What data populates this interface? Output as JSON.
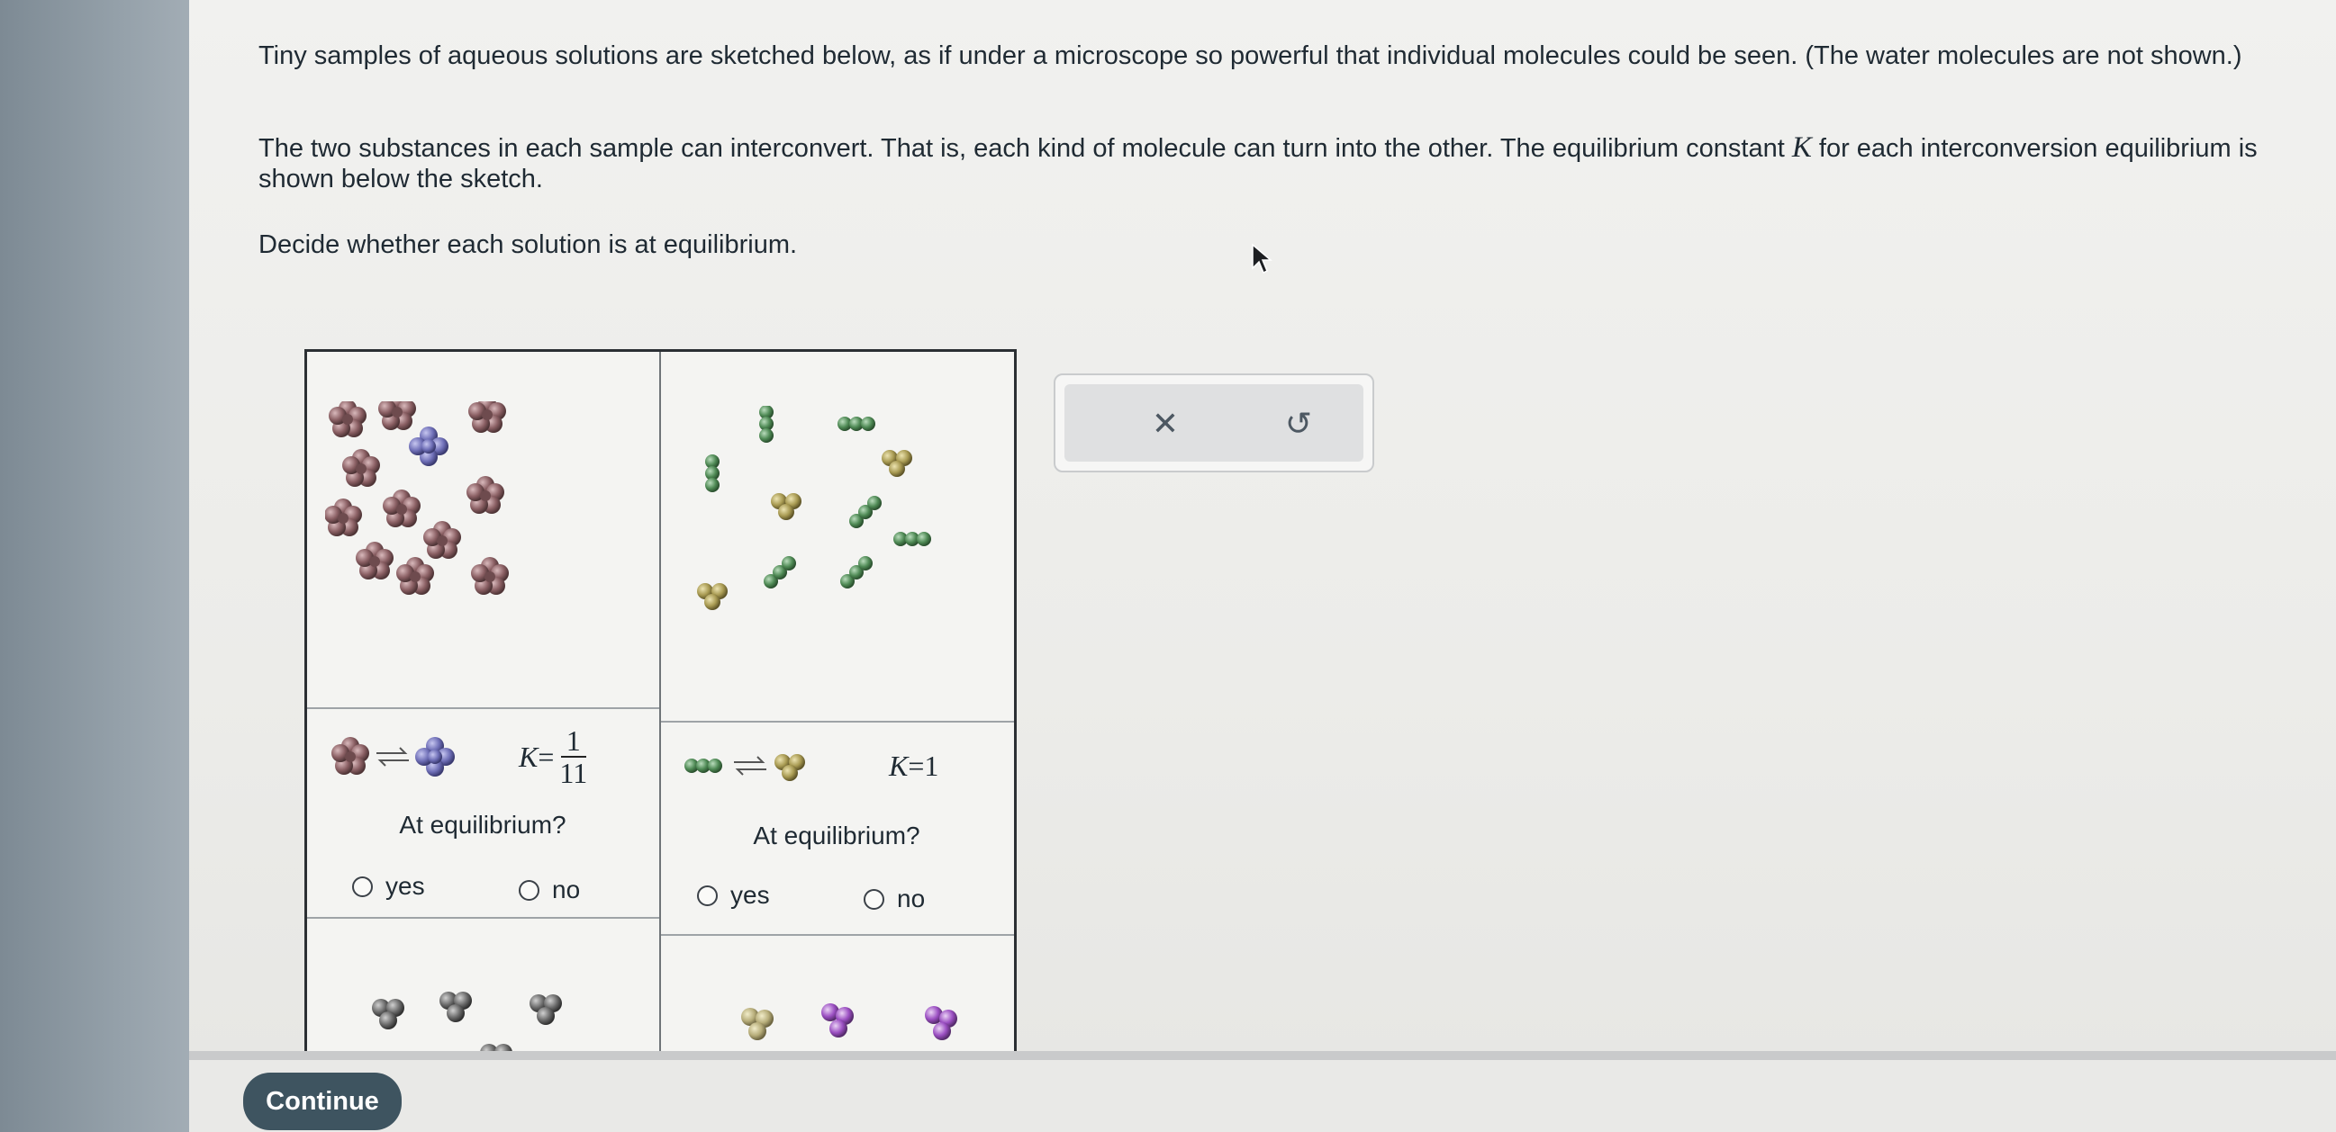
{
  "prompt": {
    "paragraph1": "Tiny samples of aqueous solutions are sketched below, as if under a microscope so powerful that individual molecules could be seen. (The water molecules are not shown.)",
    "paragraph2_part1": "The two substances in each sample can interconvert. That is, each kind of molecule can turn into the other. The equilibrium constant ",
    "paragraph2_K": "K",
    "paragraph2_part2": " for each interconversion equilibrium is shown below the sketch.",
    "paragraph3": "Decide whether each solution is at equilibrium."
  },
  "samples": [
    {
      "k_symbol": "K",
      "k_equals": "=",
      "k_numerator": "1",
      "k_denominator": "11",
      "question": "At equilibrium?",
      "yes_label": "yes",
      "no_label": "no",
      "colors": {
        "reactant": "#8a5f63",
        "product": "#6f6fb7"
      }
    },
    {
      "k_symbol": "K",
      "k_equals": "=",
      "k_value": "1",
      "question": "At equilibrium?",
      "yes_label": "yes",
      "no_label": "no",
      "colors": {
        "reactant": "#4f8a55",
        "product": "#a89a52"
      }
    }
  ],
  "toolbar": {
    "clear_icon": "close-icon",
    "clear_glyph": "✕",
    "undo_icon": "undo-icon",
    "undo_glyph": "↺"
  },
  "footer": {
    "continue_label": "Continue"
  },
  "colors": {
    "continue_bg": "#3e5460",
    "grid_border": "#2b2f33"
  }
}
